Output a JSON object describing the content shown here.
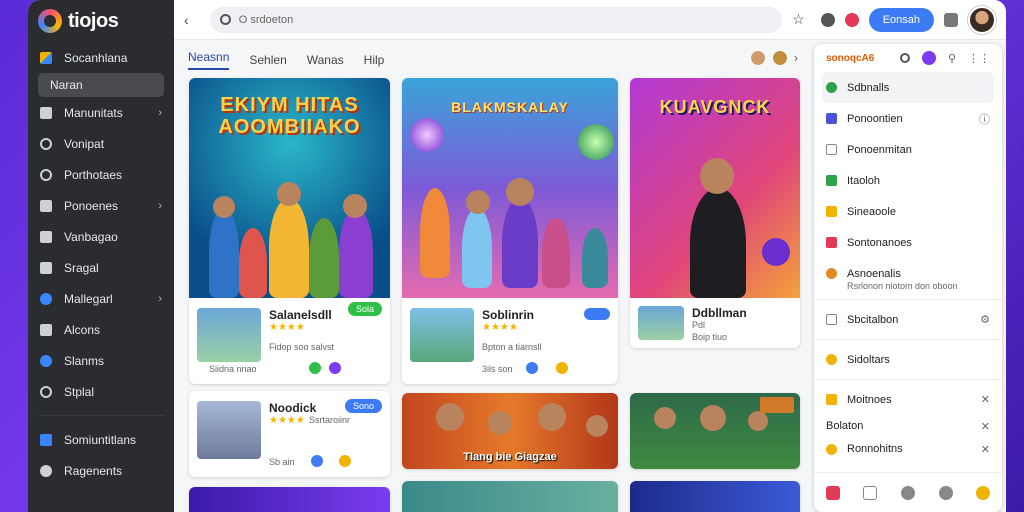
{
  "brand": {
    "name": "tiojos"
  },
  "sidebar": {
    "items": [
      {
        "label": "Socanhlana",
        "icon": "flag-icon",
        "chev": false
      },
      {
        "label": "Naran",
        "icon": "",
        "chev": false,
        "active": true
      },
      {
        "label": "Manunitats",
        "icon": "square-icon",
        "chev": true
      },
      {
        "label": "Vonipat",
        "icon": "compass-icon",
        "chev": false
      },
      {
        "label": "Porthotaes",
        "icon": "gear-icon",
        "chev": false
      },
      {
        "label": "Ponoenes",
        "icon": "box-icon",
        "chev": true
      },
      {
        "label": "Vanbagao",
        "icon": "square-icon",
        "chev": false
      },
      {
        "label": "Sragal",
        "icon": "folder-icon",
        "chev": false
      },
      {
        "label": "Mallegarl",
        "icon": "blue-dot-icon",
        "chev": true
      },
      {
        "label": "Alcons",
        "icon": "square-icon",
        "chev": false
      },
      {
        "label": "Slanms",
        "icon": "blue-dot-icon",
        "chev": false
      },
      {
        "label": "Stplal",
        "icon": "gear-icon",
        "chev": false
      }
    ],
    "bottom": [
      {
        "label": "Somiuntitlans",
        "icon": "box-icon"
      },
      {
        "label": "Ragenents",
        "icon": "user-icon"
      }
    ]
  },
  "topbar": {
    "search_value": "O srdoeton",
    "button_label": "Eonsah"
  },
  "tabs": [
    {
      "label": "Neasnn",
      "active": true
    },
    {
      "label": "Sehlen"
    },
    {
      "label": "Wanas"
    },
    {
      "label": "Hilp"
    }
  ],
  "cards": [
    {
      "title": "EKIYM HITAS\nAOOMBIIAKO",
      "info_title": "Salanelsdll",
      "meta": "Fidop soo salvst",
      "meta2": "Siidna nnao",
      "badge": "Sola"
    },
    {
      "title": "BLAKMSKALAY",
      "info_title": "Soblinrin",
      "meta": "Bpton a tiarnsll",
      "meta2": "3ils son"
    },
    {
      "title": "KUAVGNCK",
      "info_title": "Ddbllman",
      "meta": "Pdl",
      "meta2": "Boip tiuo"
    },
    {
      "info_title": "Noodick",
      "meta": "Ssrtaroiinr",
      "meta2": "Sb ain",
      "badge": "Sono"
    },
    {
      "caption": "Tlang bie Giagzae"
    },
    {
      "caption": ""
    }
  ],
  "rpanel": {
    "brand": "sonoqcA6",
    "items": [
      {
        "label": "Sdbnalls",
        "color": "#2ca24a"
      },
      {
        "label": "Ponoontien",
        "color": "#4a54d8"
      },
      {
        "label": "Ponoenmitan",
        "color": "#888888"
      },
      {
        "label": "Itaoloh",
        "color": "#2ca24a"
      },
      {
        "label": "Sineaoole",
        "color": "#f0b400"
      },
      {
        "label": "Sontonanoes",
        "color": "#e03a56"
      },
      {
        "label": "Asnoenalis",
        "color": "#e08a2a",
        "sub": "Rsrlonon niotom don oboon"
      },
      {
        "label": "Sbcitalbon",
        "color": "#ffffff"
      },
      {
        "label": "Sidoltars",
        "color": "#f0b400"
      },
      {
        "label": "Moitnoes",
        "color": "#f0b400"
      },
      {
        "label": "Bolaton",
        "color": "#ffffff"
      },
      {
        "label": "Ronnohitns",
        "color": "#f0b400"
      }
    ]
  }
}
